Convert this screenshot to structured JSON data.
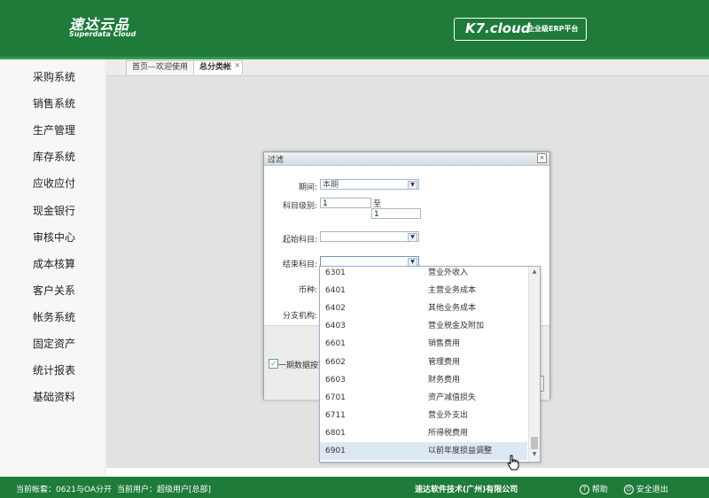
{
  "header": {
    "brand_name": "速达云品",
    "brand_sub": "Superdata Cloud",
    "product_logo": "K7.cloud",
    "product_slogan": "企业级ERP平台"
  },
  "sidebar": {
    "items": [
      {
        "label": "采购系统"
      },
      {
        "label": "销售系统"
      },
      {
        "label": "生产管理"
      },
      {
        "label": "库存系统"
      },
      {
        "label": "应收应付"
      },
      {
        "label": "现金银行"
      },
      {
        "label": "审核中心"
      },
      {
        "label": "成本核算"
      },
      {
        "label": "客户关系"
      },
      {
        "label": "帐务系统"
      },
      {
        "label": "固定资产"
      },
      {
        "label": "统计报表"
      },
      {
        "label": "基础资料"
      }
    ]
  },
  "tabs": [
    {
      "label": "首页—欢迎使用",
      "active": false
    },
    {
      "label": "总分类帐",
      "active": true,
      "close": "×"
    }
  ],
  "dialog": {
    "title": "过滤",
    "close": "×",
    "period_label": "期间:",
    "period_value": "本期",
    "level_label": "科目级别:",
    "level_from": "1",
    "level_to_label": "至",
    "level_to": "1",
    "start_subject_label": "起始科目:",
    "start_subject_value": "",
    "end_subject_label": "结束科目:",
    "end_subject_value": "",
    "currency_label": "币种:",
    "branch_label": "分支机构:",
    "checkbox_label": "一期数据按而",
    "checkbox_checked": true
  },
  "dropdown": {
    "items": [
      {
        "code": "6301",
        "name": "营业外收入"
      },
      {
        "code": "6401",
        "name": "主营业务成本"
      },
      {
        "code": "6402",
        "name": "其他业务成本"
      },
      {
        "code": "6403",
        "name": "营业税金及附加"
      },
      {
        "code": "6601",
        "name": "销售费用"
      },
      {
        "code": "6602",
        "name": "管理费用"
      },
      {
        "code": "6603",
        "name": "财务费用"
      },
      {
        "code": "6701",
        "name": "资产减值损失"
      },
      {
        "code": "6711",
        "name": "营业外支出"
      },
      {
        "code": "6801",
        "name": "所得税费用"
      },
      {
        "code": "6901",
        "name": "以前年度损益调整"
      }
    ],
    "highlighted_index": 10
  },
  "statusbar": {
    "account_set": "当前帐套：0621与OA分开",
    "current_user": "当前用户：超级用户[总部]",
    "company": "速达软件技术(广州)有限公司",
    "help_label": "帮助",
    "logout_label": "安全退出"
  },
  "colors": {
    "brand_green": "#1e7b3a",
    "highlight_row": "#dde8f5"
  }
}
